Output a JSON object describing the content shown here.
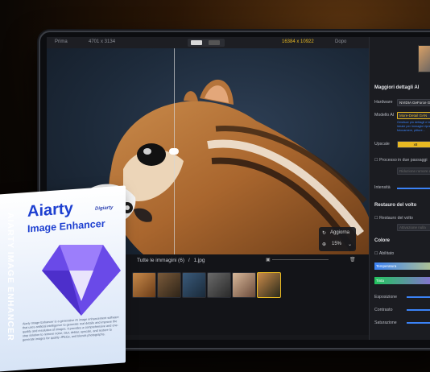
{
  "topbar": {
    "before_label": "Prima",
    "before_size": "4701 x 3134",
    "after_size": "16384 x 10922",
    "after_label": "Dopo"
  },
  "canvas": {
    "zoom_button_label": "Aggiorna",
    "zoom_value": "15%"
  },
  "filmstrip": {
    "all_images_label": "Tutte le immagini (6)",
    "separator": "/",
    "current_file": "1.jpg",
    "thumbnails": [
      "thumb-1",
      "thumb-2",
      "thumb-3",
      "thumb-4",
      "thumb-5",
      "thumb-6"
    ]
  },
  "panel": {
    "ai_section_title": "Maggiori dettagli AI",
    "hardware_label": "Hardware",
    "hardware_value": "NVIDIA GeForce GTX",
    "model_label": "Modello AI",
    "model_value": "More-Detail GAN",
    "model_desc": "Gestisce più dettagli e texture. Ideale per immagini riprese da fotocamere, pitture...",
    "upscale_label": "Upscale",
    "upscale_value": "x8",
    "denoise_label": "Processo in due passaggi",
    "denoise_sub": "Riduzione rumore alta",
    "intensity_label": "Intensità",
    "face_section_title": "Restauro del volto",
    "face_checkbox_label": "Restauro del volto",
    "face_select": "Attivazione nulla",
    "color_section_title": "Colore",
    "auto_label": "Abilitato",
    "temperature_label": "Temperatura",
    "tint_label": "Tinta",
    "exposure_label": "Esposizione",
    "contrast_label": "Contrasto",
    "saturation_label": "Saturazione"
  },
  "product_box": {
    "spine_text": "AIARTY IMAGE ENHANCER",
    "brand": "Digiarty",
    "title": "Aiarty",
    "subtitle": "Image Enhancer",
    "description": "Aiarty Image Enhancer is a generative AI image enhancement software that uses artificial intelligence to generate real details and improve the quality and resolution of images. It provides a comprehensive and one-stop solution to remove noise, blur, deblur, upscale, and restore to generate images for quality JPEGs, and blends photographs."
  },
  "colors": {
    "accent_gold": "#e8b923",
    "accent_blue": "#2b3fb0"
  }
}
